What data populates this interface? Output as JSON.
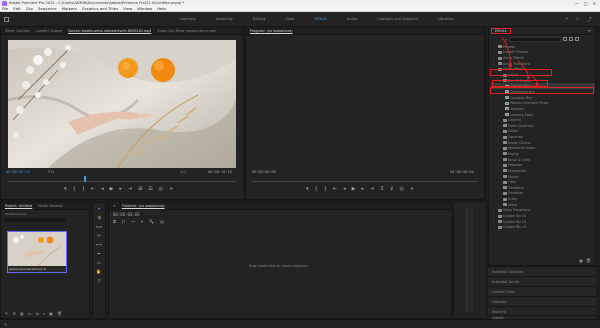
{
  "app": {
    "title": "Adobe Premiere Pro 2022 - C:\\Users\\ADMIN\\Documents\\Adobe\\Premiere Pro\\22.0\\Untitled.prproj *"
  },
  "window_controls": [
    "—",
    "□",
    "✕"
  ],
  "menu": [
    "File",
    "Edit",
    "Clip",
    "Sequence",
    "Markers",
    "Graphics and Titles",
    "View",
    "Window",
    "Help"
  ],
  "workspaces": {
    "tabs": [
      "Learning",
      "Assembly",
      "Editing",
      "Color",
      "Effects",
      "Audio",
      "Captions and Graphics",
      "Libraries"
    ],
    "active": "Effects"
  },
  "source_panel": {
    "tabs": [
      "Effect Controls",
      "Lumetri Scopes",
      "Source: pexels-anna-nekrashevich-8055230.mp4",
      "Audio Clip Mixer: pexels-anna-nekr"
    ],
    "timecode_left": "00:00:03:18",
    "fit": "Fit",
    "scale": "1/2",
    "timecode_right": "00:00:10:18"
  },
  "program_panel": {
    "tab": "Program: (no sequences)",
    "timecode_left": "00:00:00:00",
    "timecode_right": "00:00:00:00"
  },
  "project_panel": {
    "tabs": [
      "Project: Untitled",
      "Media Browser"
    ],
    "project_name": "Untitled.prproj",
    "clip_name": "pexels-anna-nekrashevich-8..."
  },
  "timeline_panel": {
    "tab": "Timeline: (no sequences)",
    "timecode": "00:00:00:00",
    "placeholder": "Drop media here to create sequence."
  },
  "effects_panel": {
    "tab": "Effects",
    "tree": [
      {
        "label": "Presets",
        "level": 0,
        "kind": "folder"
      },
      {
        "label": "Lumetri Presets",
        "level": 0,
        "kind": "folder"
      },
      {
        "label": "Audio Effects",
        "level": 0,
        "kind": "folder"
      },
      {
        "label": "Audio Transitions",
        "level": 0,
        "kind": "folder"
      },
      {
        "label": "Video Effects",
        "level": 0,
        "kind": "folder",
        "open": true
      },
      {
        "label": "Adjust",
        "level": 1,
        "kind": "folder"
      },
      {
        "label": "Blur & Sharpen",
        "level": 1,
        "kind": "folder",
        "open": true
      },
      {
        "label": "Camera Blur",
        "level": 2,
        "kind": "effect",
        "selected": true
      },
      {
        "label": "Directional Blur",
        "level": 2,
        "kind": "effect"
      },
      {
        "label": "Gaussian Blur",
        "level": 2,
        "kind": "effect"
      },
      {
        "label": "Reduce Interlace Flicker",
        "level": 2,
        "kind": "effect"
      },
      {
        "label": "Sharpen",
        "level": 2,
        "kind": "effect"
      },
      {
        "label": "Unsharp Mask",
        "level": 2,
        "kind": "effect"
      },
      {
        "label": "Channel",
        "level": 1,
        "kind": "folder"
      },
      {
        "label": "Color Correction",
        "level": 1,
        "kind": "folder"
      },
      {
        "label": "Distort",
        "level": 1,
        "kind": "folder"
      },
      {
        "label": "Generate",
        "level": 1,
        "kind": "folder"
      },
      {
        "label": "Image Control",
        "level": 1,
        "kind": "folder"
      },
      {
        "label": "Immersive Video",
        "level": 1,
        "kind": "folder"
      },
      {
        "label": "Keying",
        "level": 1,
        "kind": "folder"
      },
      {
        "label": "Noise & Grain",
        "level": 1,
        "kind": "folder"
      },
      {
        "label": "Obsolete",
        "level": 1,
        "kind": "folder"
      },
      {
        "label": "Perspective",
        "level": 1,
        "kind": "folder"
      },
      {
        "label": "Stylize",
        "level": 1,
        "kind": "folder"
      },
      {
        "label": "Time",
        "level": 1,
        "kind": "folder"
      },
      {
        "label": "Transform",
        "level": 1,
        "kind": "folder"
      },
      {
        "label": "Transition",
        "level": 1,
        "kind": "folder"
      },
      {
        "label": "Utility",
        "level": 1,
        "kind": "folder"
      },
      {
        "label": "Video",
        "level": 1,
        "kind": "folder"
      },
      {
        "label": "Video Transitions",
        "level": 0,
        "kind": "folder"
      },
      {
        "label": "Custom Bin 01",
        "level": 0,
        "kind": "folder"
      },
      {
        "label": "Custom Bin 02",
        "level": 0,
        "kind": "folder"
      },
      {
        "label": "Custom Bin 03",
        "level": 0,
        "kind": "folder"
      }
    ]
  },
  "side_panels": [
    "Essential Graphics",
    "Essential Sound",
    "Lumetri Color",
    "Libraries",
    "Markers",
    "History"
  ],
  "colors": {
    "accent": "#4a8fd9",
    "highlight": "#e02020"
  }
}
